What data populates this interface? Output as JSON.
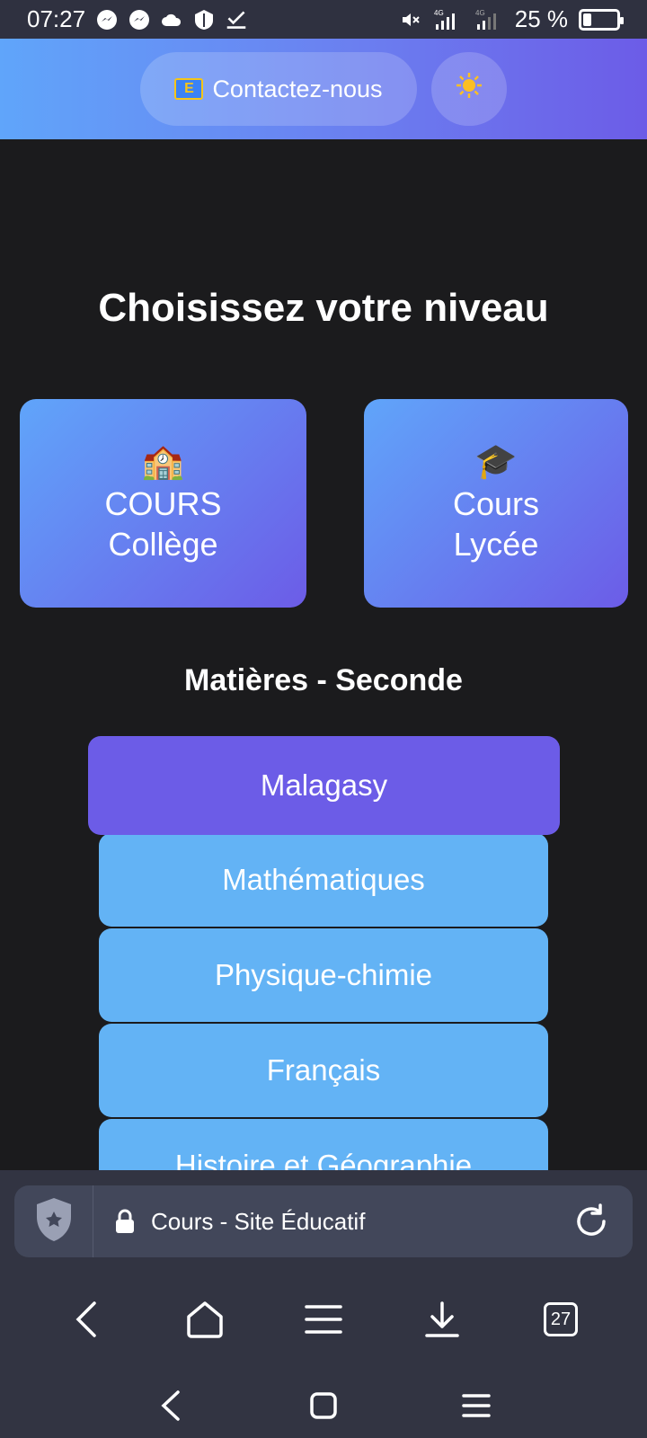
{
  "status_bar": {
    "time": "07:27",
    "battery_percent": "25 %",
    "battery_level": 0.25,
    "network_labels": [
      "4G",
      "4G"
    ]
  },
  "header": {
    "contact_label": "Contactez-nous",
    "contact_icon": "envelope-icon",
    "theme_icon": "sun-icon",
    "gradient": [
      "#60a5fa",
      "#6c5ce7"
    ]
  },
  "main": {
    "title": "Choisissez votre niveau",
    "levels": [
      {
        "emoji": "🏫",
        "line1": "COURS",
        "line2": "Collège"
      },
      {
        "emoji": "🎓",
        "line1": "Cours",
        "line2": "Lycée"
      }
    ],
    "subjects_title": "Matières - Seconde",
    "subjects": [
      "Malagasy",
      "Mathématiques",
      "Physique-chimie",
      "Français",
      "Histoire et Géographie"
    ],
    "active_subject_color": "#6c5ce7",
    "subject_color": "#63b3f5"
  },
  "browser": {
    "page_title": "Cours - Site Éducatif",
    "tab_count": "27"
  }
}
